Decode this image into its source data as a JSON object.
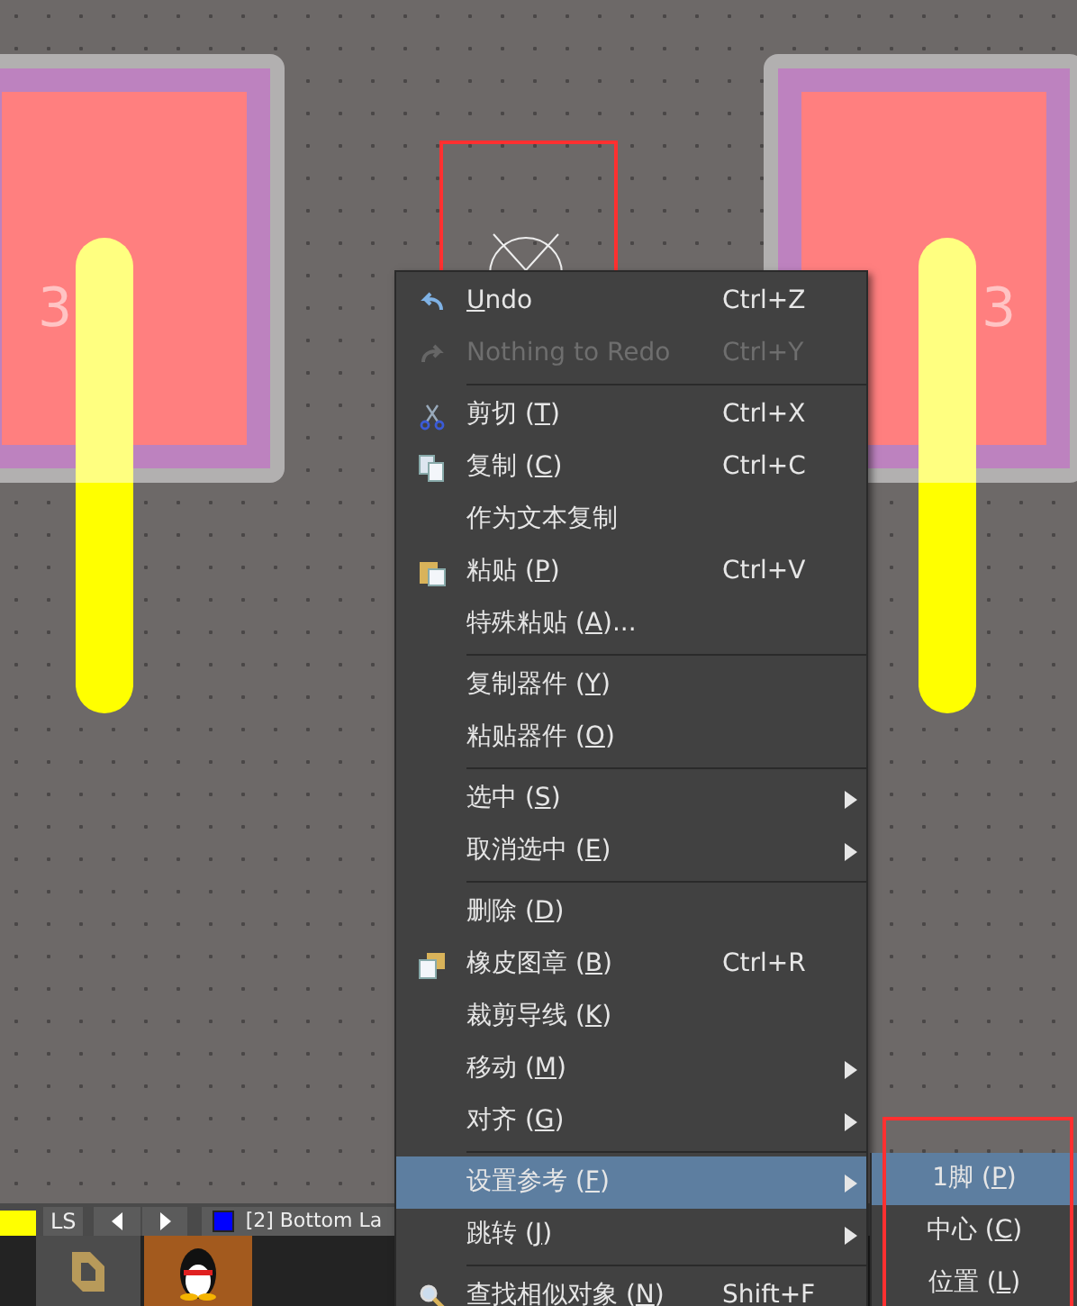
{
  "canvas": {
    "pads": [
      {
        "label": "3"
      },
      {
        "label": "3"
      }
    ]
  },
  "context_menu": {
    "groups": [
      [
        {
          "mnemonic": "U",
          "rest": "ndo",
          "shortcut": "Ctrl+Z",
          "submenu": false,
          "disabled": false,
          "selected": false
        },
        {
          "text": "Nothing to Redo",
          "shortcut": "Ctrl+Y",
          "submenu": false,
          "disabled": true,
          "selected": false
        }
      ],
      [
        {
          "text": "剪切 (",
          "mnemonic": "T",
          "rest": ")",
          "shortcut": "Ctrl+X",
          "submenu": false,
          "disabled": false,
          "selected": false
        },
        {
          "text": "复制 (",
          "mnemonic": "C",
          "rest": ")",
          "shortcut": "Ctrl+C",
          "submenu": false,
          "disabled": false,
          "selected": false
        },
        {
          "text": "作为文本复制",
          "submenu": false,
          "disabled": false,
          "selected": false
        },
        {
          "text": "粘贴 (",
          "mnemonic": "P",
          "rest": ")",
          "shortcut": "Ctrl+V",
          "submenu": false,
          "disabled": false,
          "selected": false
        },
        {
          "text": "特殊粘贴 (",
          "mnemonic": "A",
          "rest": ")...",
          "submenu": false,
          "disabled": false,
          "selected": false
        }
      ],
      [
        {
          "text": "复制器件 (",
          "mnemonic": "Y",
          "rest": ")",
          "submenu": false,
          "disabled": false,
          "selected": false
        },
        {
          "text": "粘贴器件 (",
          "mnemonic": "O",
          "rest": ")",
          "submenu": false,
          "disabled": false,
          "selected": false
        }
      ],
      [
        {
          "text": "选中 (",
          "mnemonic": "S",
          "rest": ")",
          "submenu": true,
          "disabled": false,
          "selected": false
        },
        {
          "text": "取消选中 (",
          "mnemonic": "E",
          "rest": ")",
          "submenu": true,
          "disabled": false,
          "selected": false
        }
      ],
      [
        {
          "text": "删除 (",
          "mnemonic": "D",
          "rest": ")",
          "submenu": false,
          "disabled": false,
          "selected": false
        },
        {
          "text": "橡皮图章 (",
          "mnemonic": "B",
          "rest": ")",
          "shortcut": "Ctrl+R",
          "submenu": false,
          "disabled": false,
          "selected": false
        },
        {
          "text": "裁剪导线 (",
          "mnemonic": "K",
          "rest": ")",
          "submenu": false,
          "disabled": false,
          "selected": false
        },
        {
          "text": "移动 (",
          "mnemonic": "M",
          "rest": ")",
          "submenu": true,
          "disabled": false,
          "selected": false
        },
        {
          "text": "对齐 (",
          "mnemonic": "G",
          "rest": ")",
          "submenu": true,
          "disabled": false,
          "selected": false
        }
      ],
      [
        {
          "text": "设置参考 (",
          "mnemonic": "F",
          "rest": ")",
          "submenu": true,
          "disabled": false,
          "selected": true
        },
        {
          "text": "跳转 (",
          "mnemonic": "J",
          "rest": ")",
          "submenu": true,
          "disabled": false,
          "selected": false
        }
      ],
      [
        {
          "text": "查找相似对象 (",
          "mnemonic": "N",
          "rest": ")",
          "shortcut": "Shift+F",
          "submenu": false,
          "disabled": false,
          "selected": false
        }
      ]
    ]
  },
  "submenu": {
    "items": [
      {
        "text": "1脚 (",
        "mnemonic": "P",
        "rest": ")",
        "selected": true
      },
      {
        "text": "中心 (",
        "mnemonic": "C",
        "rest": ")",
        "selected": false
      },
      {
        "text": "位置 (",
        "mnemonic": "L",
        "rest": ")",
        "selected": false
      }
    ]
  },
  "layer_bar": {
    "swatch": {
      "color": "#ffff00"
    },
    "tab": "LS",
    "layer": {
      "label": "[2] Bottom La",
      "color": "#0000ff"
    }
  }
}
